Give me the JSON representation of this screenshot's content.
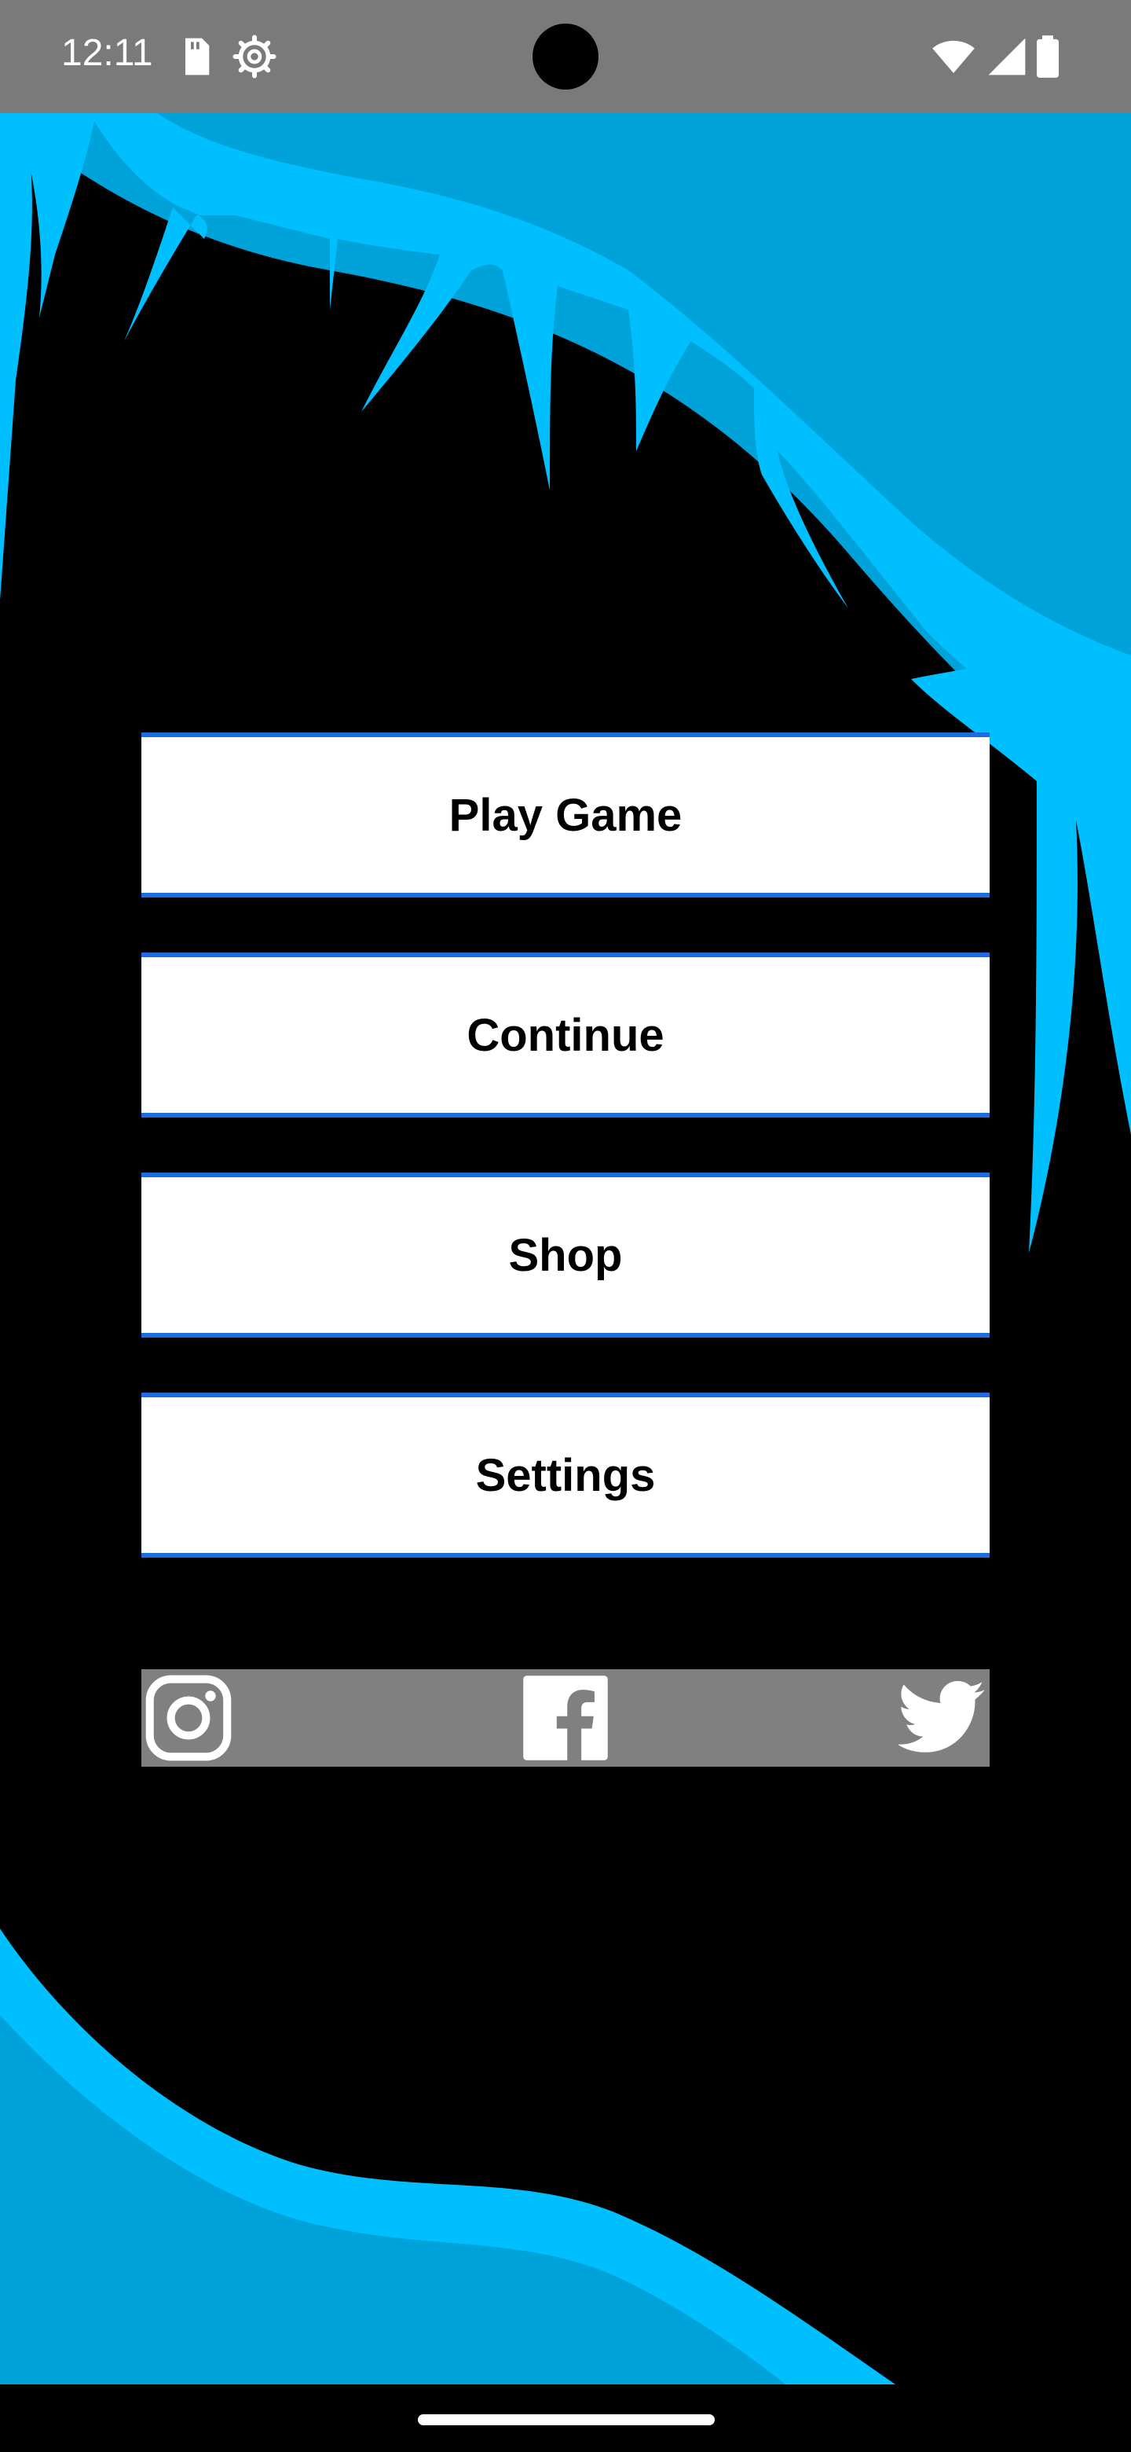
{
  "status_bar": {
    "time": "12:11",
    "icons": [
      "sd-card-icon",
      "settings-gear-icon",
      "wifi-icon",
      "cell-signal-icon",
      "battery-icon"
    ]
  },
  "menu": {
    "buttons": [
      {
        "label": "Play Game"
      },
      {
        "label": "Continue"
      },
      {
        "label": "Shop"
      },
      {
        "label": "Settings"
      }
    ]
  },
  "social": {
    "icons": [
      "instagram-icon",
      "facebook-icon",
      "twitter-icon"
    ]
  },
  "colors": {
    "background": "#000000",
    "ice_light": "#00bfff",
    "ice_dark": "#00a3d9",
    "button_bg": "#ffffff",
    "button_border": "#1a6fe0",
    "social_bar": "#808080",
    "status_bar": "#7a7a7a"
  }
}
